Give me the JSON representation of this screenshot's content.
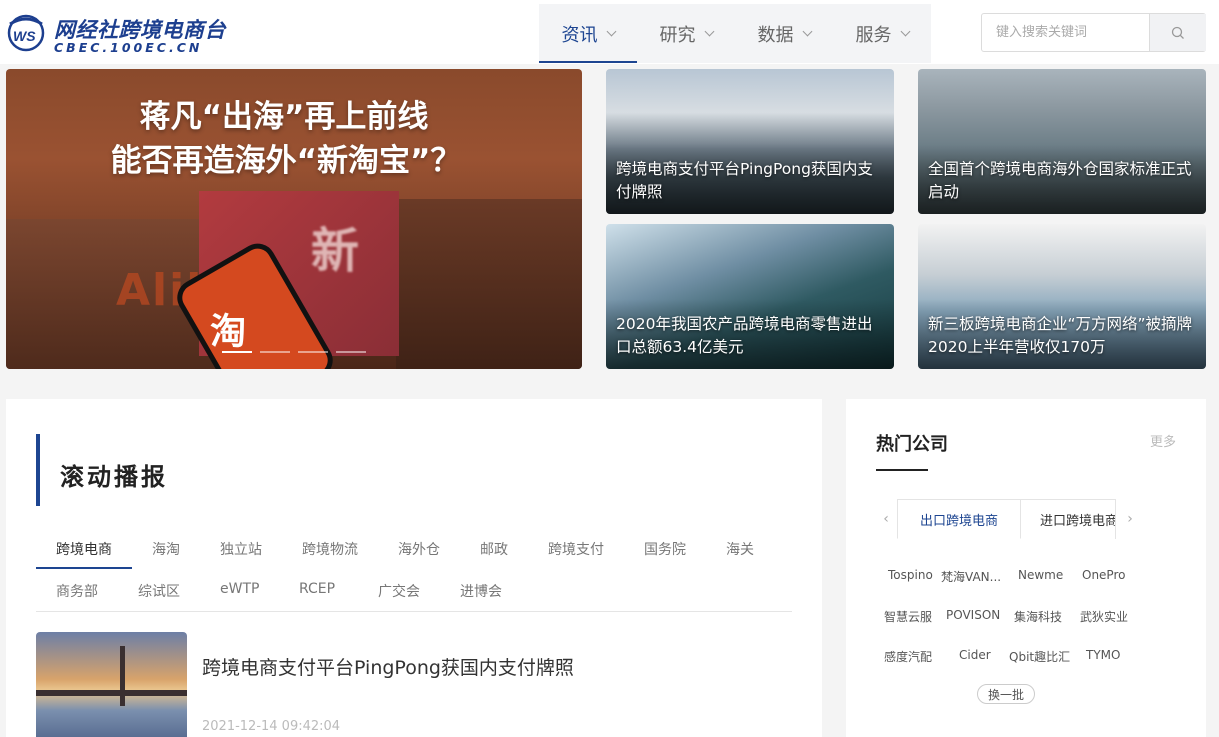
{
  "logo": {
    "title": "网经社跨境电商台",
    "subtitle": "CBEC.100EC.CN"
  },
  "nav": {
    "items": [
      {
        "label": "资讯"
      },
      {
        "label": "研究"
      },
      {
        "label": "数据"
      },
      {
        "label": "服务"
      }
    ],
    "active_index": 0
  },
  "search": {
    "placeholder": "键入搜索关键词"
  },
  "hero": {
    "headline_line1": "蒋凡“出海”再上前线",
    "headline_line2": "能否再造海外“新淘宝”？",
    "image_text_brand": "Alibaba",
    "image_text_xin": "新",
    "image_text_tao": "淘",
    "slide_count": 4,
    "active_slide": 0
  },
  "cards": [
    {
      "caption": "跨境电商支付平台PingPong获国内支付牌照"
    },
    {
      "caption": "全国首个跨境电商海外仓国家标准正式启动"
    },
    {
      "caption": "2020年我国农产品跨境电商零售进出口总额63.4亿美元"
    },
    {
      "caption": "新三板跨境电商企业“万方网络”被摘牌 2020上半年营收仅170万"
    }
  ],
  "news_section": {
    "title": "滚动播报",
    "tabs_row1": [
      "跨境电商",
      "海淘",
      "独立站",
      "跨境物流",
      "海外仓",
      "邮政",
      "跨境支付",
      "国务院",
      "海关"
    ],
    "tabs_row2": [
      "商务部",
      "综试区",
      "eWTP",
      "RCEP",
      "广交会",
      "进博会"
    ],
    "active_tab": "跨境电商",
    "items": [
      {
        "title": "跨境电商支付平台PingPong获国内支付牌照",
        "date": "2021-12-14 09:42:04"
      }
    ]
  },
  "hot_companies": {
    "title": "热门公司",
    "more_label": "更多",
    "tabs": [
      "出口跨境电商",
      "进口跨境电商"
    ],
    "active_tab": 0,
    "companies": [
      [
        "Tospino",
        "梵海VAN...",
        "Newme",
        "OnePro"
      ],
      [
        "智慧云服",
        "POVISON",
        "集海科技",
        "武狄实业"
      ],
      [
        "感度汽配",
        "Cider",
        "Qbit趣比汇",
        "TYMO"
      ]
    ],
    "refresh_label": "换一批"
  },
  "colors": {
    "brand": "#1d4591",
    "background": "#f4f4f4"
  }
}
